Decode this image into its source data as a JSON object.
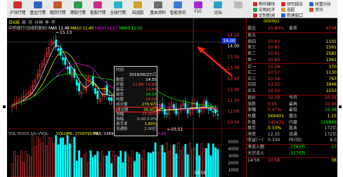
{
  "toolbar": {
    "buttons": [
      {
        "label": "沪深行情",
        "color": "#d12b2b"
      },
      {
        "label": "基金行情",
        "color": "#2b64c8"
      },
      {
        "label": "期货行情",
        "color": "#c8562b"
      },
      {
        "label": "港股行情",
        "color": "#2b9e4d"
      },
      {
        "label": "美股行情",
        "color": "#c82b8a"
      },
      {
        "label": "全球行情",
        "color": "#2bb3c8"
      },
      {
        "label": "自选股",
        "color": "#d1a02b"
      },
      {
        "label": "基本资料",
        "color": "#6b6b6b"
      },
      {
        "label": "智能资讯",
        "color": "#3a7bd5"
      },
      {
        "label": "F10",
        "color": "#9d2bd1"
      },
      {
        "label": "论坛",
        "color": "#2ba0d1"
      },
      {
        "label": "",
        "color": "#bbbbbb"
      }
    ],
    "right": [
      {
        "label": "帮你赚钱",
        "color": "#d12b2b"
      },
      {
        "label": "研究报告",
        "color": "#d12b2b"
      },
      {
        "label": "财富分析",
        "color": "#2b64c8"
      },
      {
        "label": "宏观经济",
        "color": "#2b9e4d"
      },
      {
        "label": "选股",
        "color": "#d1a02b"
      },
      {
        "label": "资讯",
        "color": "#c8562b"
      },
      {
        "label": "定制新闻",
        "color": "#d12b2b"
      },
      {
        "label": "新建窗口",
        "color": "#2b64c8"
      }
    ]
  },
  "chart": {
    "tabs": [
      "日K线",
      "周",
      "月",
      "分钟",
      "季",
      "年"
    ],
    "title": "中侨银行(日线前复权)",
    "ma": [
      {
        "label": "MA5 11.48",
        "color": "#ffffff"
      },
      {
        "label": "MA10 11.40",
        "color": "#ffff00"
      },
      {
        "label": "MA20 11.27",
        "color": "#ff00ff"
      },
      {
        "label": "MA60 12.02",
        "color": "#00ff00"
      }
    ],
    "high_label": "15.13",
    "low_label": "10.51",
    "price_axis": [
      "14.55",
      "14.00",
      "13.50",
      "13.00",
      "12.50",
      "12.00",
      "11.50",
      "11.00",
      "10.50"
    ],
    "vol_header": "VOL-TDX(5,10) VVOL·",
    "vol_values": [
      {
        "label": "VOLUME: 2709795.75",
        "color": "#ffff00"
      },
      {
        "label": "MA5: 1369141.25",
        "color": "#ffffff"
      },
      {
        "label": "MA10: 1285923.88",
        "color": "#ff00ff"
      }
    ],
    "vol_axis": [
      "5000",
      "4000",
      "3000",
      "2000",
      "1000"
    ],
    "current_price": "14.00",
    "bottom_label": "14.56"
  },
  "popup": {
    "rows": [
      {
        "k": "时间",
        "v": "",
        "vc": "#c8c8c8"
      },
      {
        "k": "",
        "v": "2018/06/27/三",
        "vc": "#ffffff"
      },
      {
        "k": "数值",
        "v": "14.55",
        "vc": "#ffffff"
      },
      {
        "k": "开盘",
        "v": "11.88 ↑0.85",
        "vc": "#ff3b3b"
      },
      {
        "k": "最高",
        "v": "14.80",
        "vc": "#ff3b3b"
      },
      {
        "k": "最低",
        "v": "14.55",
        "vc": "#00ff00"
      },
      {
        "k": "收盘",
        "v": "14.56",
        "vc": "#ff3b3b"
      },
      {
        "k": "成交量",
        "v": "270.9万",
        "vc": "#ffff00"
      },
      {
        "k": "成交额",
        "v": "25.0亿",
        "vc": "#ffff00"
      },
      {
        "k": "涨幅",
        "v": "25.80%",
        "vc": "#ff3b3b"
      },
      {
        "k": "振幅",
        "v": "0.00 0.0%",
        "vc": "#c8c8c8"
      },
      {
        "k": "换手率",
        "v": "1.60%",
        "vc": "#ffff00"
      },
      {
        "k": "流通股",
        "v": "2.00亿",
        "vc": "#c8c8c8"
      },
      {
        "k": "",
        "v": "",
        "vc": "#c8c8c8"
      }
    ]
  },
  "quote": {
    "code": "000001",
    "top": [
      {
        "a": "委比",
        "b": "25.80%",
        "bc": "#ff3b3b",
        "c": "委差",
        "d": "6758",
        "dc": "#ff3b3b"
      }
    ],
    "sells": [
      {
        "a": "卖五",
        "b": "",
        "c": "",
        "d": ""
      },
      {
        "a": "卖四",
        "b": "10.63",
        "c": "",
        "d": "1101"
      },
      {
        "a": "卖三",
        "b": "10.62",
        "c": "",
        "d": "1561"
      },
      {
        "a": "卖二",
        "b": "10.61",
        "c": "",
        "d": "2581"
      },
      {
        "a": "卖一",
        "b": "10.60",
        "c": "",
        "d": "1361"
      }
    ],
    "buys": [
      {
        "a": "买一",
        "b": "10.58",
        "c": "",
        "d": "370"
      },
      {
        "a": "买二",
        "b": "10.57",
        "c": "",
        "d": "1130"
      },
      {
        "a": "买三",
        "b": "10.56",
        "c": "",
        "d": "763"
      },
      {
        "a": "买四",
        "b": "10.55",
        "c": "",
        "d": "3946"
      },
      {
        "a": "买五",
        "b": "10.54",
        "c": "",
        "d": "2253"
      }
    ],
    "stats": [
      {
        "a": "现价",
        "b": "10.59",
        "bc": "#ff3b3b",
        "c": "今开",
        "d": "10.58",
        "dc": "#ff3b3b"
      },
      {
        "a": "涨跌",
        "b": "0.05",
        "bc": "#ff3b3b",
        "c": "最高",
        "d": "10.66",
        "dc": "#ff3b3b"
      },
      {
        "a": "涨幅",
        "b": "0.47%",
        "bc": "#ff3b3b",
        "c": "最低",
        "d": "10.48",
        "dc": "#00ff00"
      },
      {
        "a": "总量",
        "b": "569401",
        "bc": "#ffff00",
        "c": "量比",
        "d": "1.15",
        "dc": "#ffff00"
      },
      {
        "a": "外盘",
        "b": "240432",
        "bc": "#ff3b3b",
        "c": "内盘",
        "d": "328969",
        "dc": "#00ff00"
      },
      {
        "a": "换手",
        "b": "0.33%",
        "bc": "#ffff00",
        "c": "股本",
        "d": "172亿",
        "dc": "#c8c8c8"
      },
      {
        "a": "净资",
        "b": "12.35",
        "bc": "#c8c8c8",
        "c": "流通",
        "d": "172亿",
        "dc": "#c8c8c8"
      },
      {
        "a": "收益(一)",
        "b": "0.330",
        "bc": "#c8c8c8",
        "c": "PE(动)",
        "d": "8.0",
        "dc": "#c8c8c8"
      }
    ],
    "flows": [
      {
        "a": "净流入额",
        "b": "",
        "bc": "#c8c8c8",
        "c": "-7783万",
        "d": "-17",
        "dc": "#00ff00"
      },
      {
        "a": "大宗流入",
        "b": "",
        "bc": "#c8c8c8",
        "c": "-3270万",
        "d": "",
        "dc": "#00ff00"
      }
    ],
    "tick": [
      {
        "a": "14:56",
        "b": "10.58",
        "bc": "#ff3b3b",
        "c": "",
        "d": "38",
        "dc": "#ffff00"
      }
    ]
  }
}
